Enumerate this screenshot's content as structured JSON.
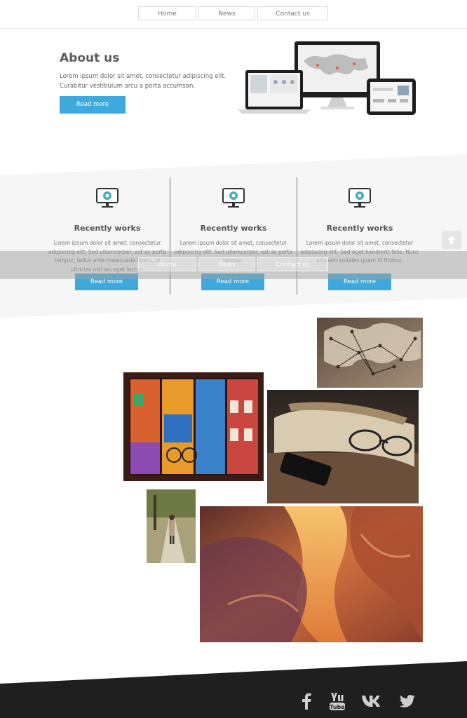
{
  "nav": {
    "items": [
      "Home",
      "News",
      "Contact us"
    ]
  },
  "about": {
    "title": "About us",
    "text": "Lorem ipsum dolor sit amet, consectetur adipiscing elit. Curabitur vestibulum arcu a porta accumsan.",
    "button": "Read more"
  },
  "works": [
    {
      "title": "Recently works",
      "text": "Lorem ipsum dolor sit amet, consectetur adipiscing elit. Sed ullamcorper, est ac porta tempor, tellus ante malesuada libero, id ultricies nisl leo eget lectus.",
      "button": "Read more",
      "icon": "monitor-aperture-icon"
    },
    {
      "title": "Recently works",
      "text": "Lorem ipsum dolor sit amet, consectetur adipiscing elit. Sed ullamcorper, est ac porta tempor,",
      "button": "Read more",
      "icon": "monitor-aperture-icon"
    },
    {
      "title": "Recently works",
      "text": "Lorem ipsum dolor sit amet, consectetur adipiscing elit. Sed eget hendrerit felis. Nunc aliquam sodales quam id finibus.",
      "button": "Read more",
      "icon": "monitor-aperture-icon"
    }
  ],
  "gallery": [
    "world-map-pins-photo",
    "colorful-houses-photo",
    "book-glasses-phone-photo",
    "woman-walking-path-photo",
    "sandstone-canyon-photo"
  ],
  "footer": {
    "social": [
      "facebook-icon",
      "youtube-icon",
      "vk-icon",
      "twitter-icon"
    ]
  },
  "colors": {
    "accent": "#3fa9dc",
    "band": "#f6f6f6",
    "footer": "#1f1f1f"
  }
}
